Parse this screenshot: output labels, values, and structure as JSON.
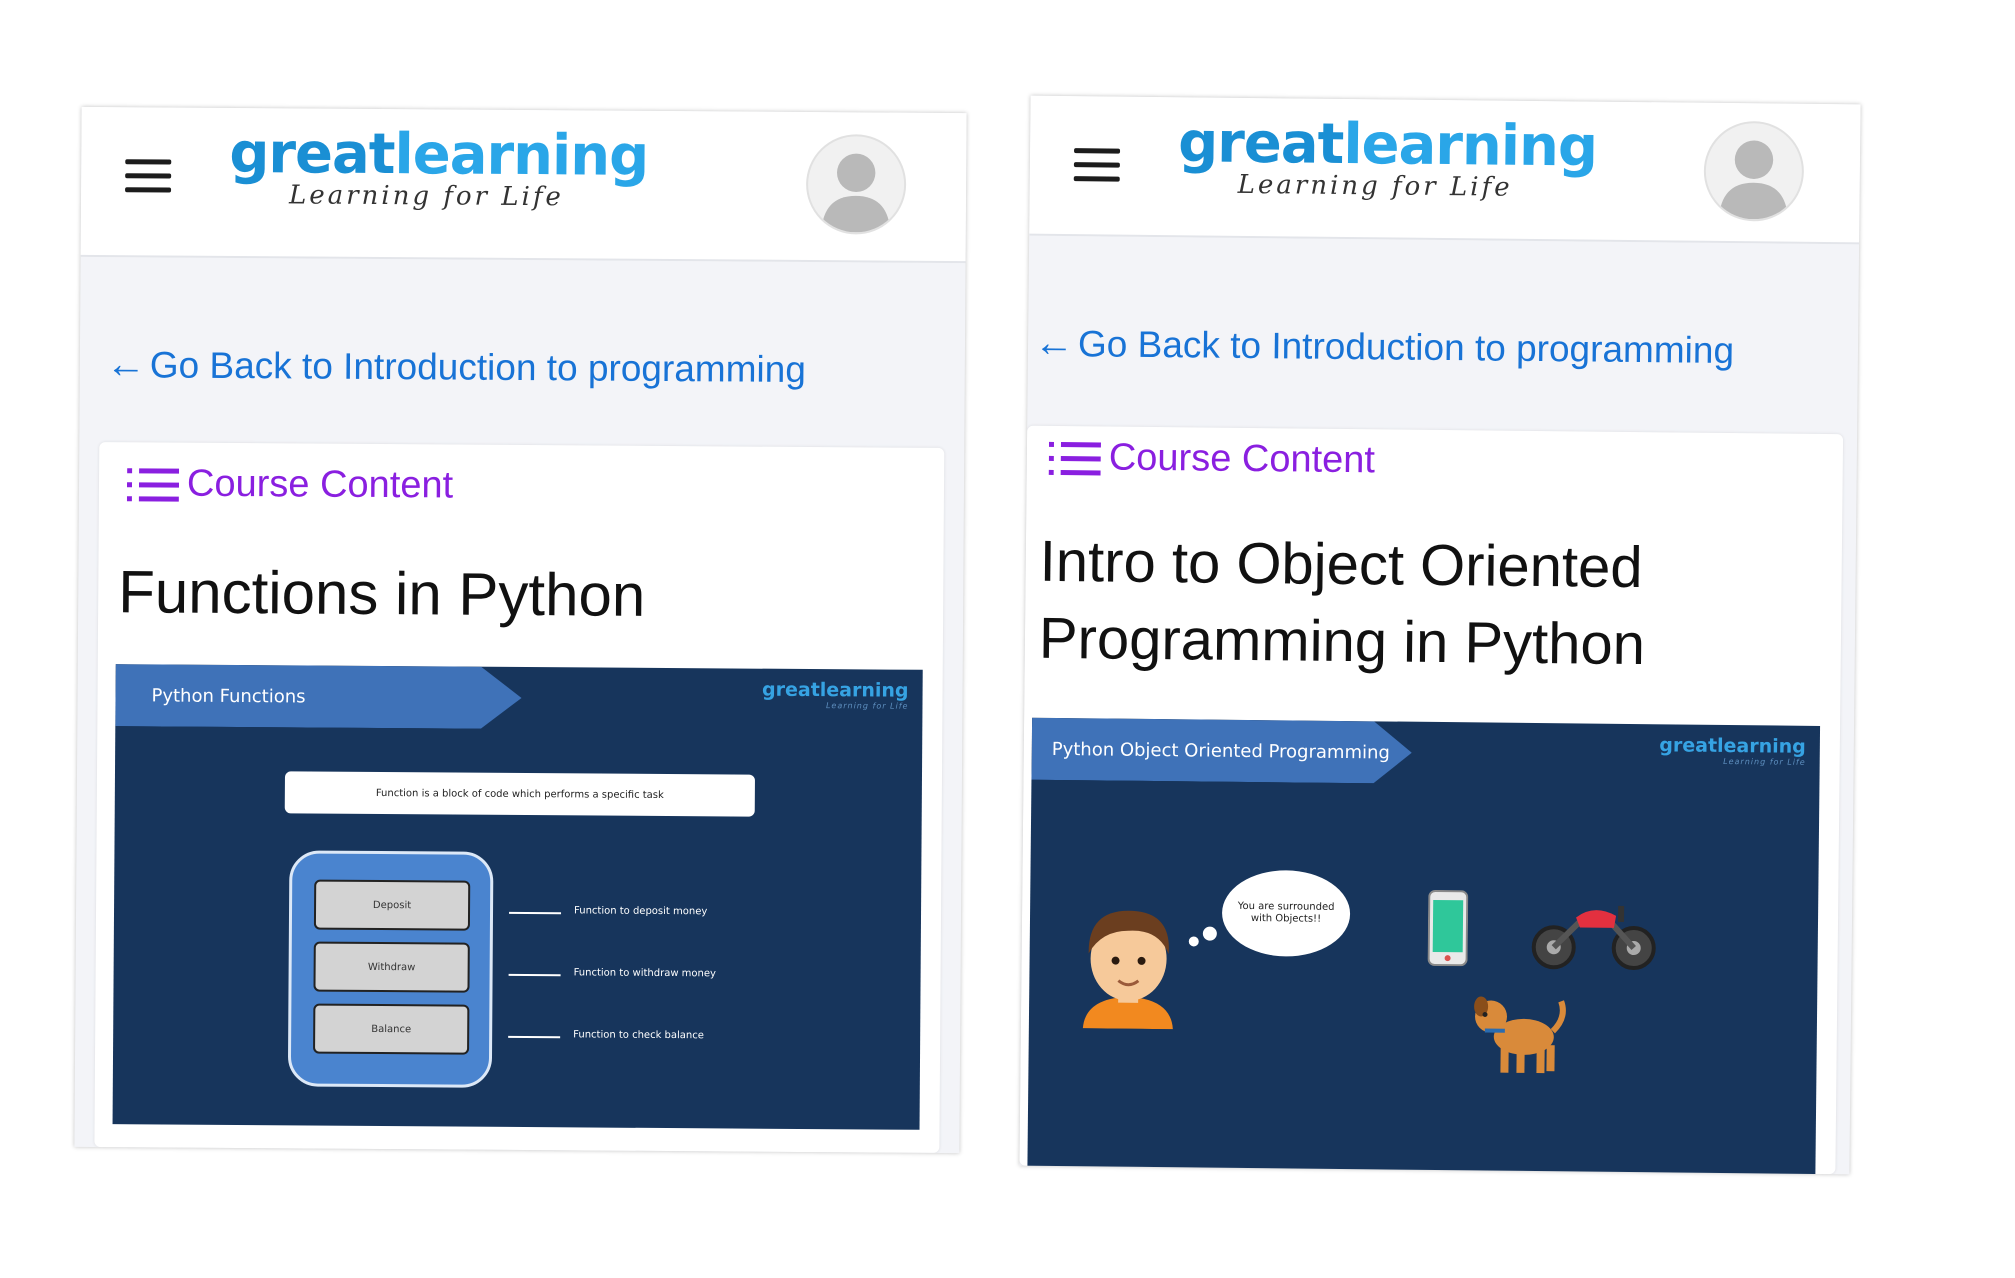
{
  "app": {
    "logo_main_part1": "great",
    "logo_main_part2": "learning",
    "logo_tagline": "Learning for Life"
  },
  "left": {
    "back_link": "Go Back to Introduction to programming",
    "section_label": "Course Content",
    "course_title": "Functions in Python",
    "slide": {
      "banner": "Python Functions",
      "logo_main": "greatlearning",
      "logo_tag": "Learning for Life",
      "definition": "Function is a block of code which performs a specific task",
      "buttons": [
        "Deposit",
        "Withdraw",
        "Balance"
      ],
      "descriptions": [
        "Function to deposit money",
        "Function to withdraw money",
        "Function to check balance"
      ]
    }
  },
  "right": {
    "back_link": "Go Back to Introduction to programming",
    "section_label": "Course Content",
    "course_title_line1": "Intro to Object Oriented",
    "course_title_line2": "Programming in Python",
    "slide": {
      "banner": "Python Object Oriented Programming",
      "logo_main": "greatlearning",
      "logo_tag": "Learning for Life",
      "thought_bubble": "You are surrounded with Objects!!"
    }
  },
  "colors": {
    "link_blue": "#1873d6",
    "course_purple": "#8a1fe0",
    "slide_navy": "#17355c",
    "banner_blue": "#3f72b8"
  },
  "icons": [
    "hamburger-icon",
    "avatar-icon",
    "back-arrow-icon",
    "list-icon",
    "boy-icon",
    "phone-icon",
    "motorbike-icon",
    "dog-icon"
  ]
}
